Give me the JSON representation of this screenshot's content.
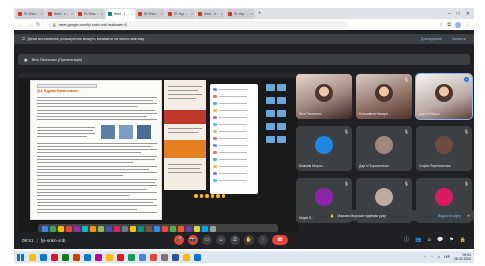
{
  "browser": {
    "tabs": [
      {
        "title": "7Б Фізична культур",
        "active": false
      },
      {
        "title": "Meet - vsh-kxay-vs",
        "active": false
      },
      {
        "title": "7Б Фізична культур",
        "active": false
      },
      {
        "title": "Meet - fyi-sokn-xnb",
        "active": true
      },
      {
        "title": "9Б Фізична культур",
        "active": false
      },
      {
        "title": "7Б Укр мова 22.02",
        "active": false
      },
      {
        "title": "Meet - hsr-yyjg-cos",
        "active": false
      },
      {
        "title": "7Б Укр. мова 23.02",
        "active": false
      }
    ],
    "new_tab": "+",
    "window_controls": [
      "–",
      "□",
      "✕"
    ],
    "nav_back": "←",
    "nav_forward": "→",
    "reload": "↻",
    "url": "meet.google.com/fyi-sokn-xnb?authuser=0"
  },
  "extension_warning": {
    "text": "Деякі встановлені розширення можуть впливати на якість виклику",
    "action_details": "Докладніше",
    "action_close": "Закрити"
  },
  "presenting": {
    "label": "Віта Панченко (Презентація)"
  },
  "slide": {
    "heading": "§14. Будова й властивості",
    "reactions": [
      "😀",
      "😀",
      "😀",
      "😀",
      "😀",
      "😀",
      "😀"
    ]
  },
  "participants": [
    {
      "name": "Віта Панченко",
      "type": "camera"
    },
    {
      "name": "Єлизавета Назаре...",
      "type": "camera"
    },
    {
      "name": "Дар'я Рябуха",
      "type": "camera",
      "speaking": true
    },
    {
      "name": "Максим Мороз...",
      "type": "avatar"
    },
    {
      "name": "Дар'я Поросятенко",
      "type": "avatar"
    },
    {
      "name": "Софія Перелиснова",
      "type": "avatar"
    },
    {
      "name": "Марія Б...",
      "type": "avatar"
    },
    {
      "name": "",
      "type": "avatar"
    },
    {
      "name": "",
      "type": "avatar"
    }
  ],
  "toast": {
    "text": "Максим Морозов піднімає руку",
    "action": "Відкрити чергу",
    "close": "✕"
  },
  "call": {
    "time": "09:51",
    "separator": "|",
    "code": "fyi-sokn-xnb",
    "buttons": [
      "🎤",
      "📷",
      "▭",
      "☺",
      "⎚",
      "✋",
      "⋮"
    ],
    "end": "☎",
    "right_icons": [
      "ⓘ",
      "👥",
      "💬",
      "⚑",
      "🔒"
    ],
    "participant_count": "13"
  },
  "taskbar": {
    "apps": [
      "#ffb900",
      "#0078d4",
      "#e81123",
      "#107c10",
      "#d83b01",
      "#0078d4",
      "#b4009e",
      "#ffb900",
      "#e81123",
      "#0f9d58",
      "#4285f4",
      "#ea4335",
      "#7a7574",
      "#2b579a",
      "#ffb900",
      "#0078d4"
    ],
    "lang": "УКР",
    "clock_time": "09:51",
    "clock_date": "28.02.2024"
  }
}
